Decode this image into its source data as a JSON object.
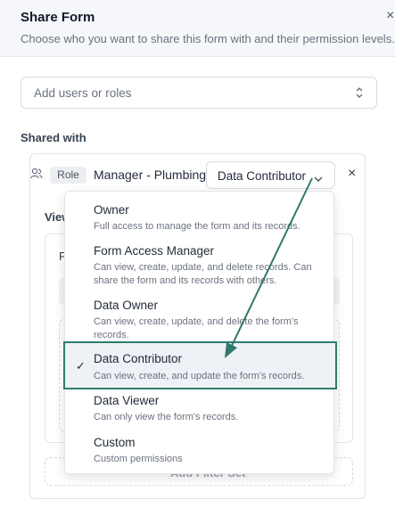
{
  "header": {
    "title": "Share Form",
    "subtitle": "Choose who you want to share this form with and their permission levels.",
    "close_icon": "×"
  },
  "add_users": {
    "placeholder": "Add users or roles"
  },
  "shared_with": {
    "label": "Shared with",
    "entry": {
      "badge": "Role",
      "name": "Manager - Plumbing",
      "permission": "Data Contributor",
      "remove_icon": "×"
    }
  },
  "behind": {
    "view_label": "View",
    "f_label": "F",
    "add_filter_label": "Add Filter Set"
  },
  "menu": {
    "options": [
      {
        "name": "Owner",
        "desc": "Full access to manage the form and its records."
      },
      {
        "name": "Form Access Manager",
        "desc": "Can view, create, update, and delete records. Can share the form and its records with others."
      },
      {
        "name": "Data Owner",
        "desc": "Can view, create, update, and delete the form's records."
      },
      {
        "name": "Data Contributor",
        "desc": "Can view, create, and update the form's records."
      },
      {
        "name": "Data Viewer",
        "desc": "Can only view the form's records."
      },
      {
        "name": "Custom",
        "desc": "Custom permissions"
      }
    ],
    "selected_index": 3,
    "check_glyph": "✓"
  },
  "colors": {
    "highlight": "#2f7a6b"
  }
}
